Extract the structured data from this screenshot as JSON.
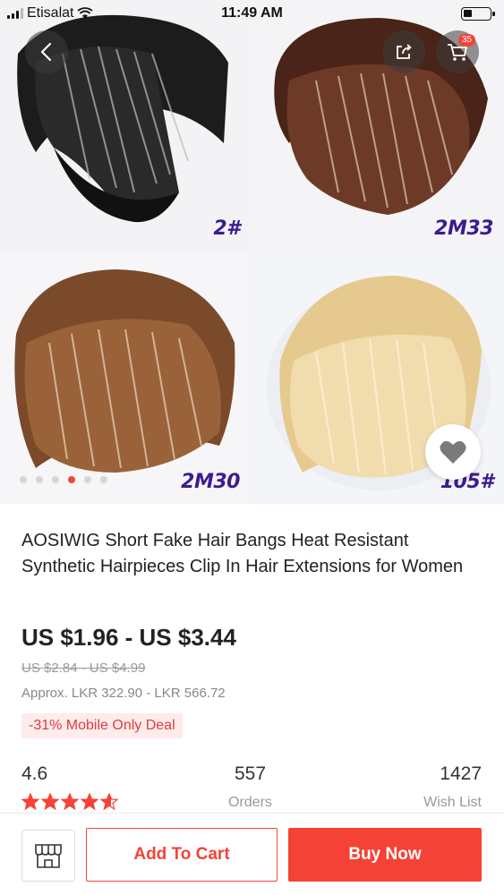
{
  "status_bar": {
    "carrier": "Etisalat",
    "time": "11:49 AM",
    "battery_level": 0.35
  },
  "gallery": {
    "tiles": [
      {
        "label": "2#",
        "color": "#2b2b2b"
      },
      {
        "label": "2M33",
        "color": "#6b3a2a"
      },
      {
        "label": "2M30",
        "color": "#8a5a35"
      },
      {
        "label": "105#",
        "color": "#e8cf98"
      }
    ],
    "cart_count": "35",
    "dot_count": 6,
    "active_dot": 3,
    "icons": {
      "back": "chevron-left-icon",
      "share": "share-icon",
      "cart": "cart-icon",
      "favorite": "heart-icon"
    }
  },
  "product": {
    "title": "AOSIWIG Short Fake Hair Bangs Heat Resistant Synthetic Hairpieces Clip In Hair Extensions for Women",
    "price": "US $1.96 - US $3.44",
    "old_price": "US $2.84 - US $4.99",
    "approx": "Approx. LKR 322.90 - LKR 566.72",
    "deal": "-31% Mobile Only Deal"
  },
  "stats": {
    "rating": "4.6",
    "rating_value": 4.6,
    "orders_value": "557",
    "orders_label": "Orders",
    "wishlist_value": "1427",
    "wishlist_label": "Wish List"
  },
  "actions": {
    "add_to_cart": "Add To Cart",
    "buy_now": "Buy Now"
  },
  "colors": {
    "accent": "#f44336",
    "star": "#f44336",
    "label_purple": "#3b1d8f"
  }
}
